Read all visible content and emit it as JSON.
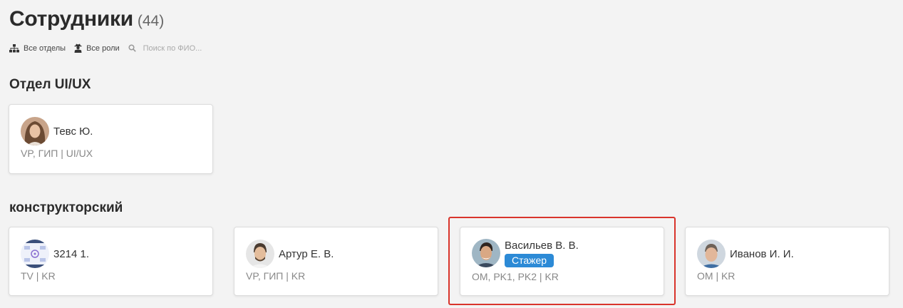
{
  "header": {
    "title": "Сотрудники",
    "count": "(44)"
  },
  "filters": {
    "departments_label": "Все отделы",
    "roles_label": "Все роли",
    "search_placeholder": "Поиск по ФИО..."
  },
  "sections": [
    {
      "title": "Отдел UI/UX",
      "employees": [
        {
          "name": "Тевс Ю.",
          "roles": "VP, ГИП | UI/UX"
        }
      ]
    },
    {
      "title": "конструкторский",
      "employees": [
        {
          "name": "3214 1.",
          "roles": "TV | KR"
        },
        {
          "name": "Артур Е. В.",
          "roles": "VP, ГИП | KR"
        },
        {
          "name": "Васильев В. В.",
          "badge": "Стажер",
          "roles": "OM, PK1, PK2 | KR"
        },
        {
          "name": "Иванов И. И.",
          "roles": "OM | KR"
        }
      ]
    }
  ],
  "colors": {
    "badge": "#2c8ad6",
    "highlight": "#d9342b",
    "background": "#f3f3f3"
  },
  "icons": [
    "sitemap-icon",
    "user-secret-icon",
    "search-icon"
  ]
}
